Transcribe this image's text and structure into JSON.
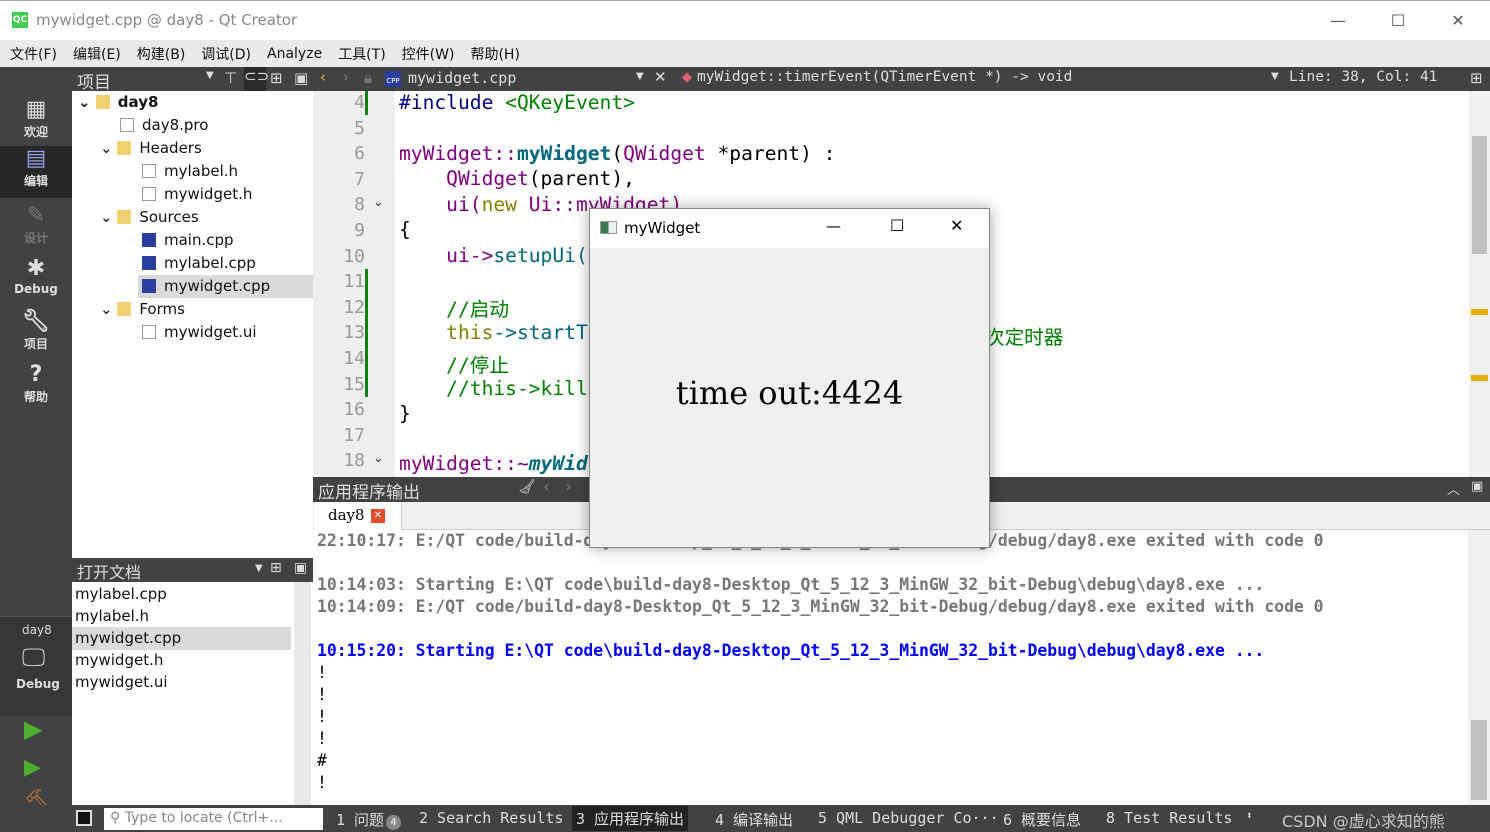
{
  "window": {
    "title": "mywidget.cpp @ day8 - Qt Creator",
    "logo": "QC"
  },
  "menu": [
    "文件(F)",
    "编辑(E)",
    "构建(B)",
    "调试(D)",
    "Analyze",
    "工具(T)",
    "控件(W)",
    "帮助(H)"
  ],
  "toolbar": {
    "project_label": "项目",
    "file": "mywidget.cpp",
    "function": "myWidget::timerEvent(QTimerEvent *) -> void",
    "position": "Line: 38, Col: 41"
  },
  "modes": [
    {
      "label": "欢迎",
      "icon": "grid-icon"
    },
    {
      "label": "编辑",
      "icon": "edit-icon"
    },
    {
      "label": "设计",
      "icon": "pencil-icon"
    },
    {
      "label": "Debug",
      "icon": "bug-icon"
    },
    {
      "label": "项目",
      "icon": "wrench-icon"
    },
    {
      "label": "帮助",
      "icon": "help-icon"
    }
  ],
  "kit": {
    "project": "day8",
    "mode": "Debug"
  },
  "tree": [
    "day8",
    "day8.pro",
    "Headers",
    "mylabel.h",
    "mywidget.h",
    "Sources",
    "main.cpp",
    "mylabel.cpp",
    "mywidget.cpp",
    "Forms",
    "mywidget.ui"
  ],
  "open_docs": {
    "title": "打开文档",
    "items": [
      "mylabel.cpp",
      "mylabel.h",
      "mywidget.cpp",
      "mywidget.h",
      "mywidget.ui"
    ]
  },
  "code": {
    "line_numbers": [
      "4",
      "5",
      "6",
      "7",
      "8",
      "9",
      "10",
      "11",
      "12",
      "13",
      "14",
      "15",
      "16",
      "17",
      "18"
    ],
    "l4a": "#include",
    "l4b": " <QKeyEvent>",
    "l6a": "myWidget::",
    "l6b": "myWidget",
    "l6c": "(",
    "l6d": "QWidget",
    " l6e": "",
    "l6f": " *parent) :",
    "l7a": "    QWidget",
    "l7b": "(parent),",
    "l8a": "    ui(",
    "l8b": "new",
    "l8c": " Ui::myWidget)",
    "l9": "{",
    "l10a": "    ui->",
    "l10b": "setupUi(",
    "l12": "    //启动",
    "l13a": "    this",
    "l13b": "->startT",
    "l13tail": "次定时器",
    "l14": "    //停止",
    "l15": "    //this->kill",
    "l16": "}",
    "l18a": "myWidget::~",
    "l18b": "myWid"
  },
  "output": {
    "title": "应用程序输出",
    "tab": "day8",
    "lines": [
      "22:10:17: E:/QT code/build-day8-Desktop_Qt_5_12_3_MinGW_32_bit-Debug/debug/day8.exe exited with code 0",
      "10:14:03: Starting E:\\QT code\\build-day8-Desktop_Qt_5_12_3_MinGW_32_bit-Debug\\debug\\day8.exe ...",
      "10:14:09: E:/QT code/build-day8-Desktop_Qt_5_12_3_MinGW_32_bit-Debug/debug/day8.exe exited with code 0",
      "10:15:20: Starting E:\\QT code\\build-day8-Desktop_Qt_5_12_3_MinGW_32_bit-Debug\\debug\\day8.exe ...",
      "!",
      "!",
      "!",
      "!",
      "#",
      "!"
    ]
  },
  "status": {
    "locate_placeholder": "Type to locate (Ctrl+...",
    "tabs": [
      "1 问题",
      "2 Search Results",
      "3 应用程序输出",
      "4 编译输出",
      "5 QML Debugger Co···",
      "6 概要信息",
      "8 Test Results"
    ],
    "issues_count": "4",
    "watermark": "CSDN @虚心求知的熊"
  },
  "dialog": {
    "title": "myWidget",
    "message": "time out:4424"
  },
  "colors": {
    "dark": "#404244",
    "keyword": "#808000",
    "type": "#800080",
    "function": "#00677c",
    "comment": "#008000",
    "output_blue": "#0000ff"
  }
}
